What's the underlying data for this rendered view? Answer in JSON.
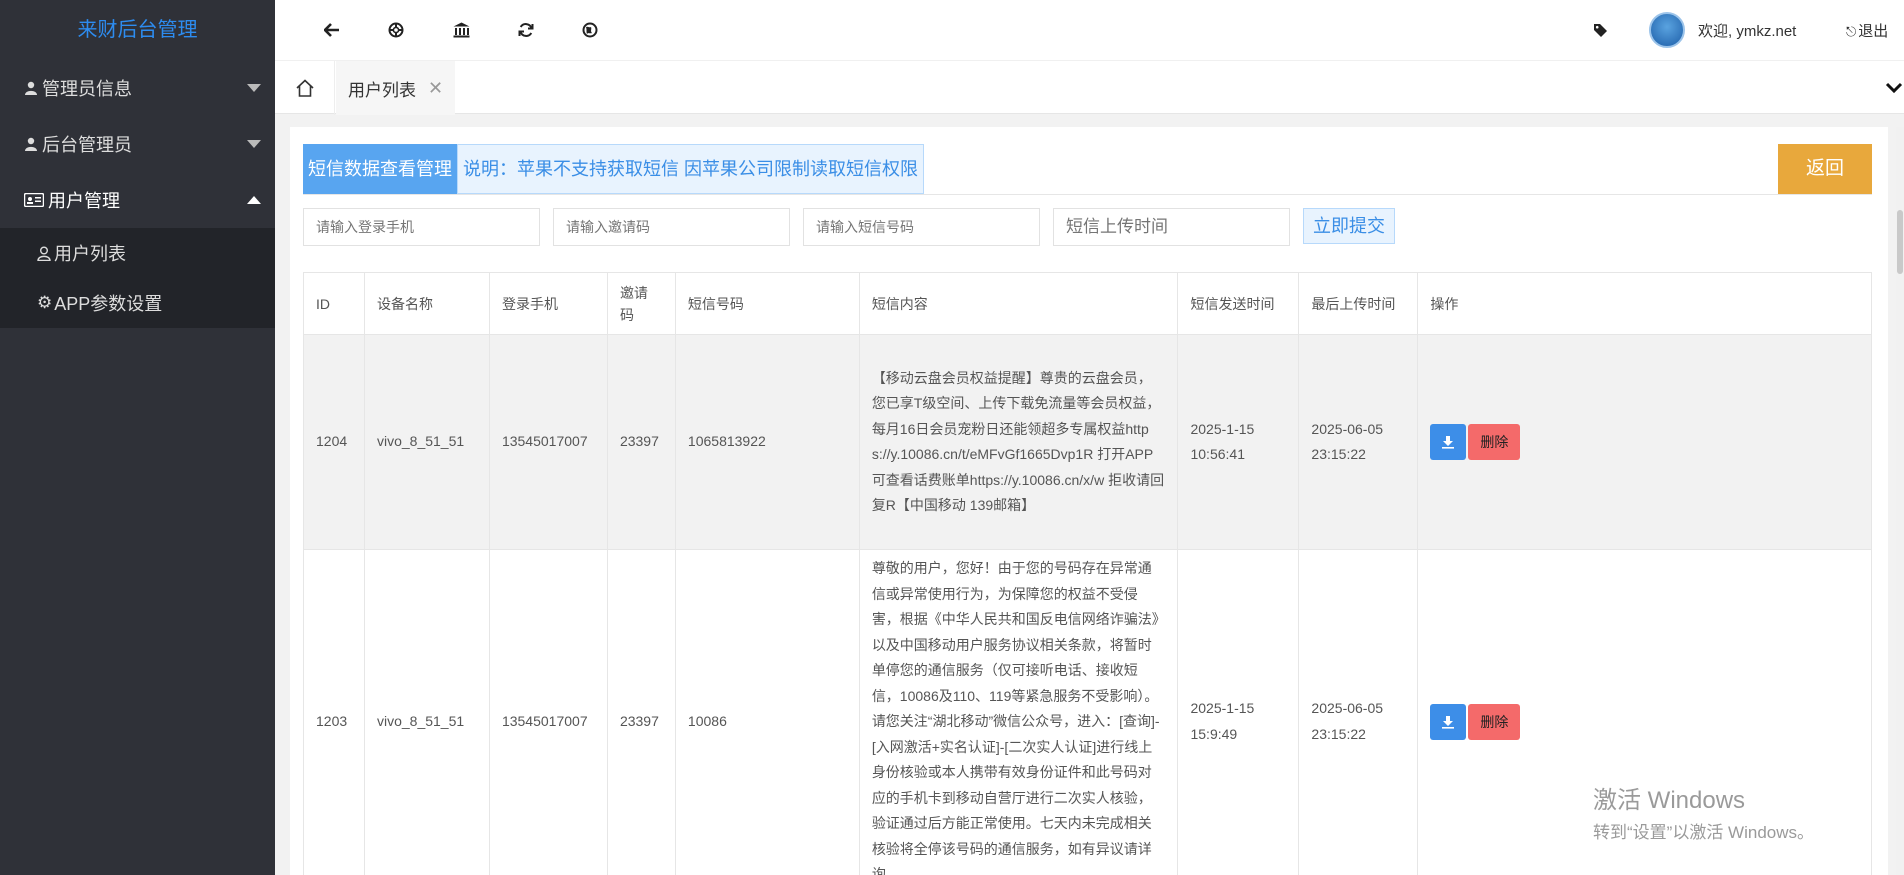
{
  "sidebar": {
    "brand": "来财后台管理",
    "groups": [
      {
        "label": "管理员信息",
        "icon": "user-icon",
        "expanded": false
      },
      {
        "label": "后台管理员",
        "icon": "user-icon",
        "expanded": false
      },
      {
        "label": "用户管理",
        "icon": "id-card-icon",
        "expanded": true
      }
    ],
    "sub_items": [
      {
        "label": "用户列表",
        "icon": "user-outline-icon"
      },
      {
        "label": "APP参数设置",
        "icon": "gear-icon"
      }
    ]
  },
  "header": {
    "icons": [
      "arrow-left-icon",
      "lifebuoy-icon",
      "bank-icon",
      "refresh-icon",
      "globe-icon"
    ],
    "tag_icon": "tag-icon",
    "welcome": "欢迎, ymkz.net",
    "logout": "退出"
  },
  "tabs": {
    "active": "用户列表",
    "close": "✕"
  },
  "panel": {
    "title": "短信数据查看管理",
    "note": "说明：苹果不支持获取短信 因苹果公司限制读取短信权限",
    "back": "返回",
    "filters": {
      "phone_placeholder": "请输入登录手机",
      "invite_placeholder": "请输入邀请码",
      "sms_placeholder": "请输入短信号码",
      "time_placeholder": "短信上传时间"
    },
    "submit": "立即提交"
  },
  "table": {
    "headers": [
      "ID",
      "设备名称",
      "登录手机",
      "邀请码",
      "短信号码",
      "短信内容",
      "短信发送时间",
      "最后上传时间",
      "操作"
    ],
    "rows": [
      {
        "id": "1204",
        "device": "vivo_8_51_51",
        "phone": "13545017007",
        "invite": "23397",
        "sms_number": "1065813922",
        "content": "【移动云盘会员权益提醒】尊贵的云盘会员，您已享T级空间、上传下载免流量等会员权益，每月16日会员宠粉日还能领超多专属权益https://y.10086.cn/t/eMFvGf1665Dvp1R 打开APP可查看话费账单https://y.10086.cn/x/w 拒收请回复R【中国移动 139邮箱】",
        "send_date": "2025-1-15",
        "send_time": "10:56:41",
        "upload_date": "2025-06-05",
        "upload_time": "23:15:22",
        "delete": "删除"
      },
      {
        "id": "1203",
        "device": "vivo_8_51_51",
        "phone": "13545017007",
        "invite": "23397",
        "sms_number": "10086",
        "content": "尊敬的用户，您好！由于您的号码存在异常通信或异常使用行为，为保障您的权益不受侵害，根据《中华人民共和国反电信网络诈骗法》以及中国移动用户服务协议相关条款，将暂时单停您的通信服务（仅可接听电话、接收短信，10086及110、119等紧急服务不受影响）。请您关注“湖北移动”微信公众号，进入：[查询]-[入网激活+实名认证]-[二次实人认证]进行线上身份核验或本人携带有效身份证件和此号码对应的手机卡到移动自营厅进行二次实人核验，验证通过后方能正常使用。七天内未完成相关核验将全停该号码的通信服务，如有异议请详询",
        "send_date": "2025-1-15",
        "send_time": "15:9:49",
        "upload_date": "2025-06-05",
        "upload_time": "23:15:22",
        "delete": "删除"
      }
    ]
  },
  "watermark": {
    "line1": "激活 Windows",
    "line2": "转到“设置”以激活 Windows。"
  },
  "colors": {
    "sidebar_bg": "#2f3138",
    "brand": "#2d8cf0",
    "title_bg": "#58a5f0",
    "back_btn": "#e8a83c",
    "delete_btn": "#f46a6a",
    "download_btn": "#3d8ee8"
  }
}
